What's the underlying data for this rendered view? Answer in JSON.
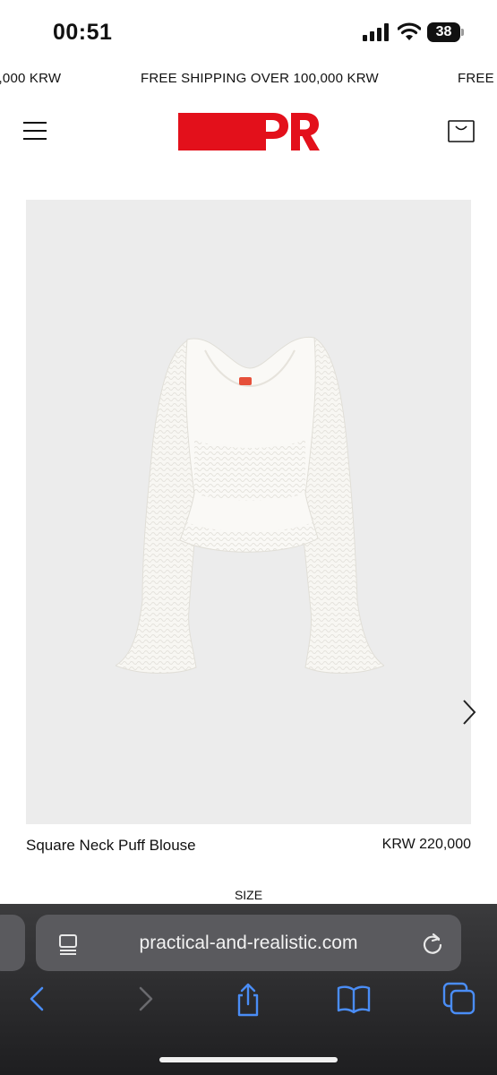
{
  "status_bar": {
    "time": "00:51",
    "battery": "38",
    "battery_level": 0.38
  },
  "announcement": {
    "left": "0,000 KRW",
    "center": "FREE SHIPPING OVER 100,000 KRW",
    "right": "FREE"
  },
  "header": {
    "logo_text": "PR",
    "brand_color": "#e3101b"
  },
  "product": {
    "name": "Square Neck Puff Blouse",
    "price": "KRW 220,000",
    "size_label": "SIZE",
    "image_background": "#ececec"
  },
  "browser": {
    "url": "practical-and-realistic.com",
    "accent_color": "#4a8df6",
    "toolbar": [
      "back-icon",
      "forward-icon",
      "share-icon",
      "bookmarks-icon",
      "tabs-icon"
    ]
  }
}
